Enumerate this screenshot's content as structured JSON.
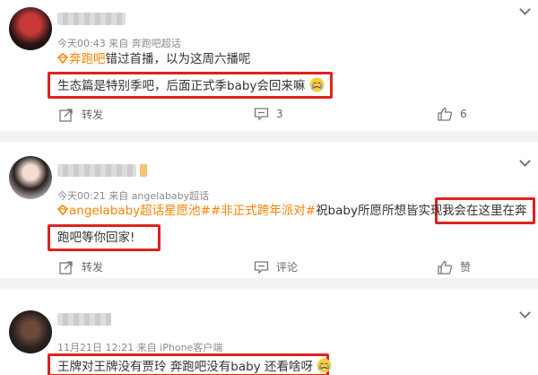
{
  "posts": [
    {
      "meta": "今天00:43 来自 奔跑吧超话",
      "tag": "奔跑吧",
      "line1_rest": "错过首播，以为这周六播呢",
      "line2": "生态篇是特别季吧，后面正式季baby会回来嘛",
      "emoji": "crying-face-icon",
      "actions": {
        "forward": "转发",
        "comment": "3",
        "like": "6"
      }
    },
    {
      "meta": "今天00:21 来自 angelababy超话",
      "tags": "angelababy超话星愿池##非正式跨年派对#",
      "line1_rest": "祝baby所愿所想皆实现，",
      "line1_hl": "我会在这里在奔",
      "line2_hl": "跑吧等你回家!",
      "actions": {
        "forward": "转发",
        "comment": "评论",
        "like": "赞"
      }
    },
    {
      "meta": "11月21日 12:21 来自 iPhone客户端",
      "line1_hl": "王牌对王牌没有贾玲 奔跑吧没有baby 还看啥呀",
      "emoji": "crying-face-icon"
    }
  ],
  "colors": {
    "highlight": "#e0221f",
    "tag": "#ff8200",
    "meta": "#8a8a8a"
  }
}
